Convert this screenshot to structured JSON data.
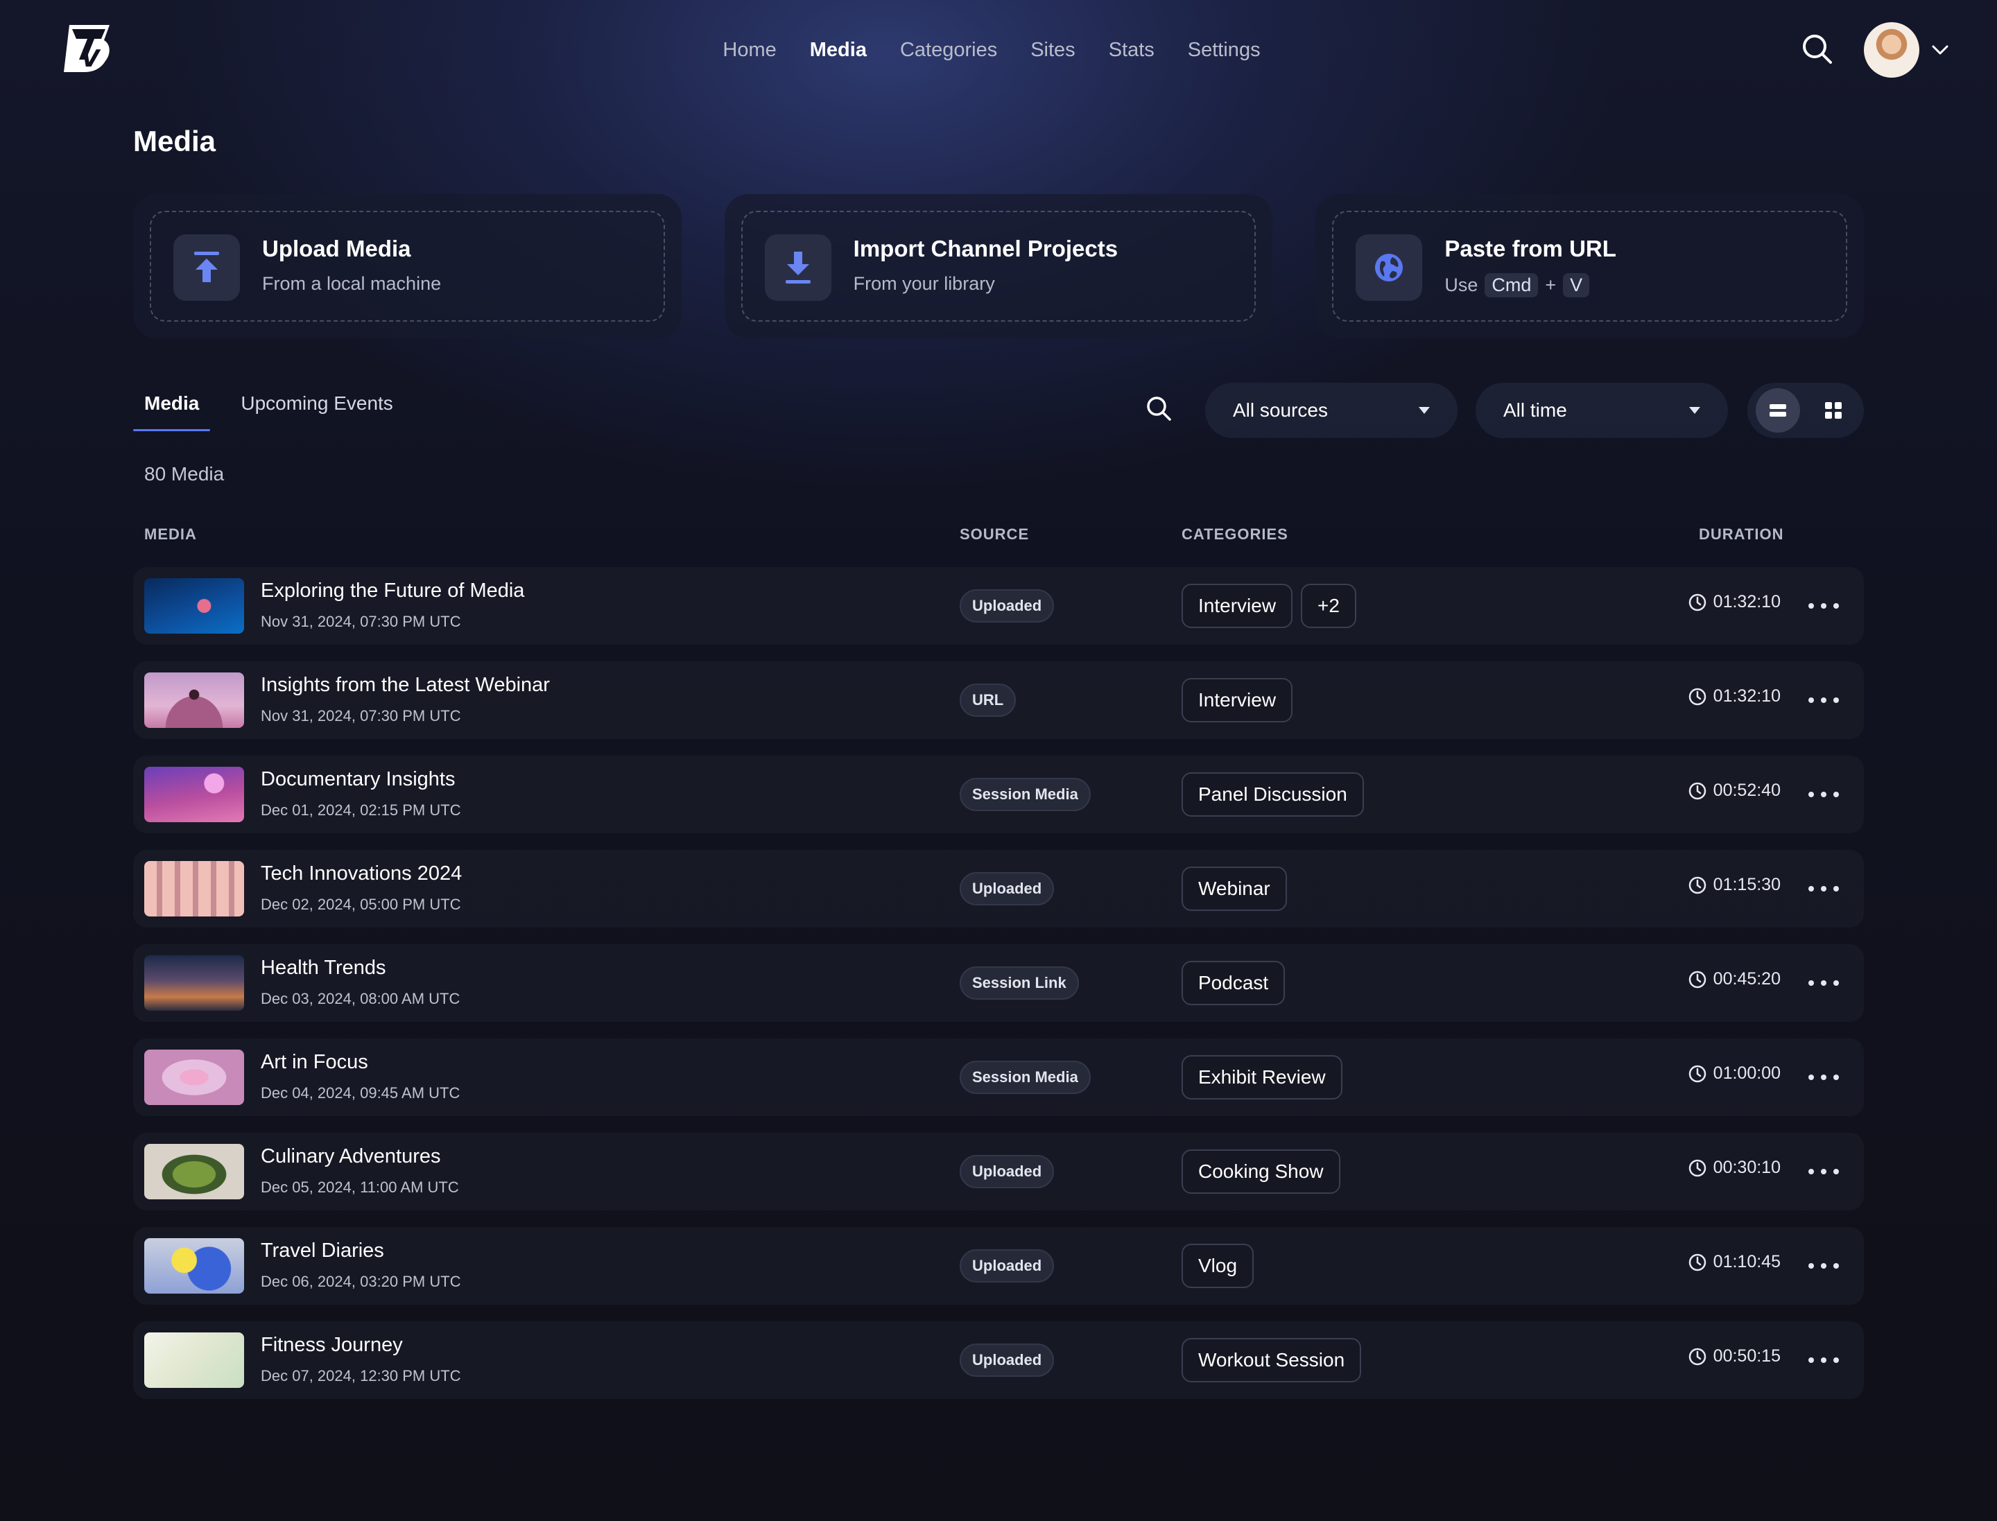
{
  "nav": {
    "logo_text": "TV",
    "items": [
      {
        "label": "Home",
        "active": false
      },
      {
        "label": "Media",
        "active": true
      },
      {
        "label": "Categories",
        "active": false
      },
      {
        "label": "Sites",
        "active": false
      },
      {
        "label": "Stats",
        "active": false
      },
      {
        "label": "Settings",
        "active": false
      }
    ]
  },
  "page": {
    "title": "Media"
  },
  "actions": [
    {
      "icon": "upload-icon",
      "title": "Upload Media",
      "subtitle": "From a local machine"
    },
    {
      "icon": "download-icon",
      "title": "Import Channel Projects",
      "subtitle": "From your library"
    },
    {
      "icon": "globe-icon",
      "title": "Paste from URL",
      "subtitle_prefix": "Use",
      "key1": "Cmd",
      "plus": "+",
      "key2": "V"
    }
  ],
  "tabs": [
    {
      "label": "Media",
      "active": true
    },
    {
      "label": "Upcoming Events",
      "active": false
    }
  ],
  "filters": {
    "source": "All sources",
    "time": "All time",
    "view": "list"
  },
  "count": "80 Media",
  "table": {
    "headers": {
      "media": "MEDIA",
      "source": "SOURCE",
      "categories": "CATEGORIES",
      "duration": "DURATION"
    },
    "rows": [
      {
        "title": "Exploring the Future of Media",
        "date": "Nov 31, 2024, 07:30 PM UTC",
        "source": "Uploaded",
        "category": "Interview",
        "extra": "+2",
        "duration": "01:32:10"
      },
      {
        "title": "Insights from the Latest Webinar",
        "date": "Nov 31, 2024, 07:30 PM UTC",
        "source": "URL",
        "category": "Interview",
        "extra": "",
        "duration": "01:32:10"
      },
      {
        "title": "Documentary Insights",
        "date": "Dec 01, 2024, 02:15 PM UTC",
        "source": "Session Media",
        "category": "Panel Discussion",
        "extra": "",
        "duration": "00:52:40"
      },
      {
        "title": "Tech Innovations 2024",
        "date": "Dec 02, 2024, 05:00 PM UTC",
        "source": "Uploaded",
        "category": "Webinar",
        "extra": "",
        "duration": "01:15:30"
      },
      {
        "title": "Health Trends",
        "date": "Dec 03, 2024, 08:00 AM UTC",
        "source": "Session Link",
        "category": "Podcast",
        "extra": "",
        "duration": "00:45:20"
      },
      {
        "title": "Art in Focus",
        "date": "Dec 04, 2024, 09:45 AM UTC",
        "source": "Session Media",
        "category": "Exhibit Review",
        "extra": "",
        "duration": "01:00:00"
      },
      {
        "title": "Culinary Adventures",
        "date": "Dec 05, 2024, 11:00 AM UTC",
        "source": "Uploaded",
        "category": "Cooking Show",
        "extra": "",
        "duration": "00:30:10"
      },
      {
        "title": "Travel Diaries",
        "date": "Dec 06, 2024, 03:20 PM UTC",
        "source": "Uploaded",
        "category": "Vlog",
        "extra": "",
        "duration": "01:10:45"
      },
      {
        "title": "Fitness Journey",
        "date": "Dec 07, 2024, 12:30 PM UTC",
        "source": "Uploaded",
        "category": "Workout Session",
        "extra": "",
        "duration": "00:50:15"
      }
    ]
  },
  "colors": {
    "accent": "#5a78f0",
    "background": "#101220"
  }
}
